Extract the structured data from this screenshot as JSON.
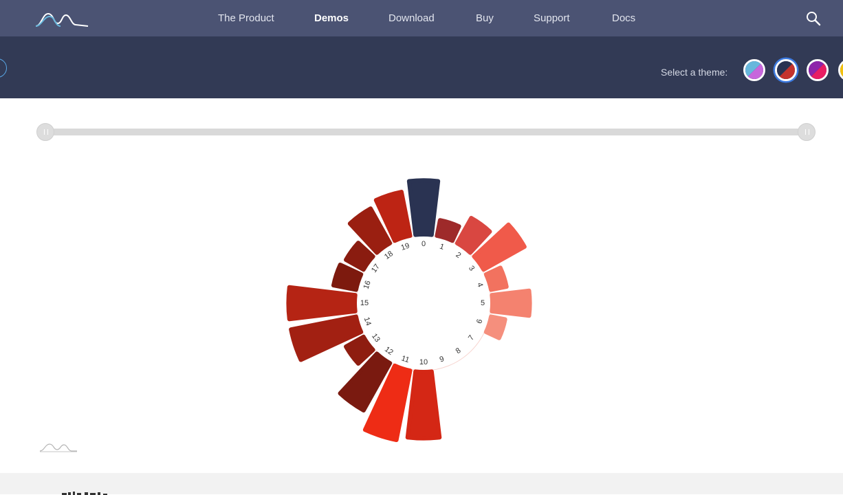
{
  "nav": {
    "items": [
      {
        "label": "The Product",
        "active": false
      },
      {
        "label": "Demos",
        "active": true
      },
      {
        "label": "Download",
        "active": false
      },
      {
        "label": "Buy",
        "active": false
      },
      {
        "label": "Support",
        "active": false
      },
      {
        "label": "Docs",
        "active": false
      }
    ],
    "logo_icon": "amcharts-logo-icon",
    "search_icon": "search-icon"
  },
  "theme_bar": {
    "label": "Select a theme:",
    "selected_index": 1,
    "themes": [
      {
        "icon": "theme-swatch-icon",
        "colors": [
          "#67b7dc",
          "#c767dc"
        ]
      },
      {
        "icon": "theme-swatch-icon",
        "colors": [
          "#2a3352",
          "#c4332d"
        ]
      },
      {
        "icon": "theme-swatch-icon",
        "colors": [
          "#8e24aa",
          "#e91e63"
        ]
      },
      {
        "icon": "theme-swatch-icon",
        "colors": [
          "#f4c20d",
          "#f4c20d"
        ]
      }
    ]
  },
  "slider": {
    "start": 0,
    "end": 1
  },
  "chart_data": {
    "type": "bar",
    "layout": "radial",
    "categories": [
      "0",
      "1",
      "2",
      "3",
      "4",
      "5",
      "6",
      "7",
      "8",
      "9",
      "10",
      "11",
      "12",
      "13",
      "14",
      "15",
      "16",
      "17",
      "18",
      "19"
    ],
    "values": [
      75,
      22,
      40,
      65,
      22,
      52,
      20,
      0,
      0,
      0,
      92,
      98,
      75,
      28,
      92,
      92,
      32,
      28,
      55,
      62
    ],
    "ylim": [
      0,
      100
    ],
    "colors": [
      "#2a3352",
      "#9e2a2a",
      "#d94741",
      "#f05a4a",
      "#f2725f",
      "#f4826f",
      "#f58f7d",
      "#f7a092",
      "#f8ad9f",
      "#fab9ad",
      "#d42715",
      "#ee2c15",
      "#7a1a10",
      "#8e1d10",
      "#a22012",
      "#b52414",
      "#7d1a0e",
      "#8a1c10",
      "#9a1f11",
      "#bd2414"
    ]
  }
}
